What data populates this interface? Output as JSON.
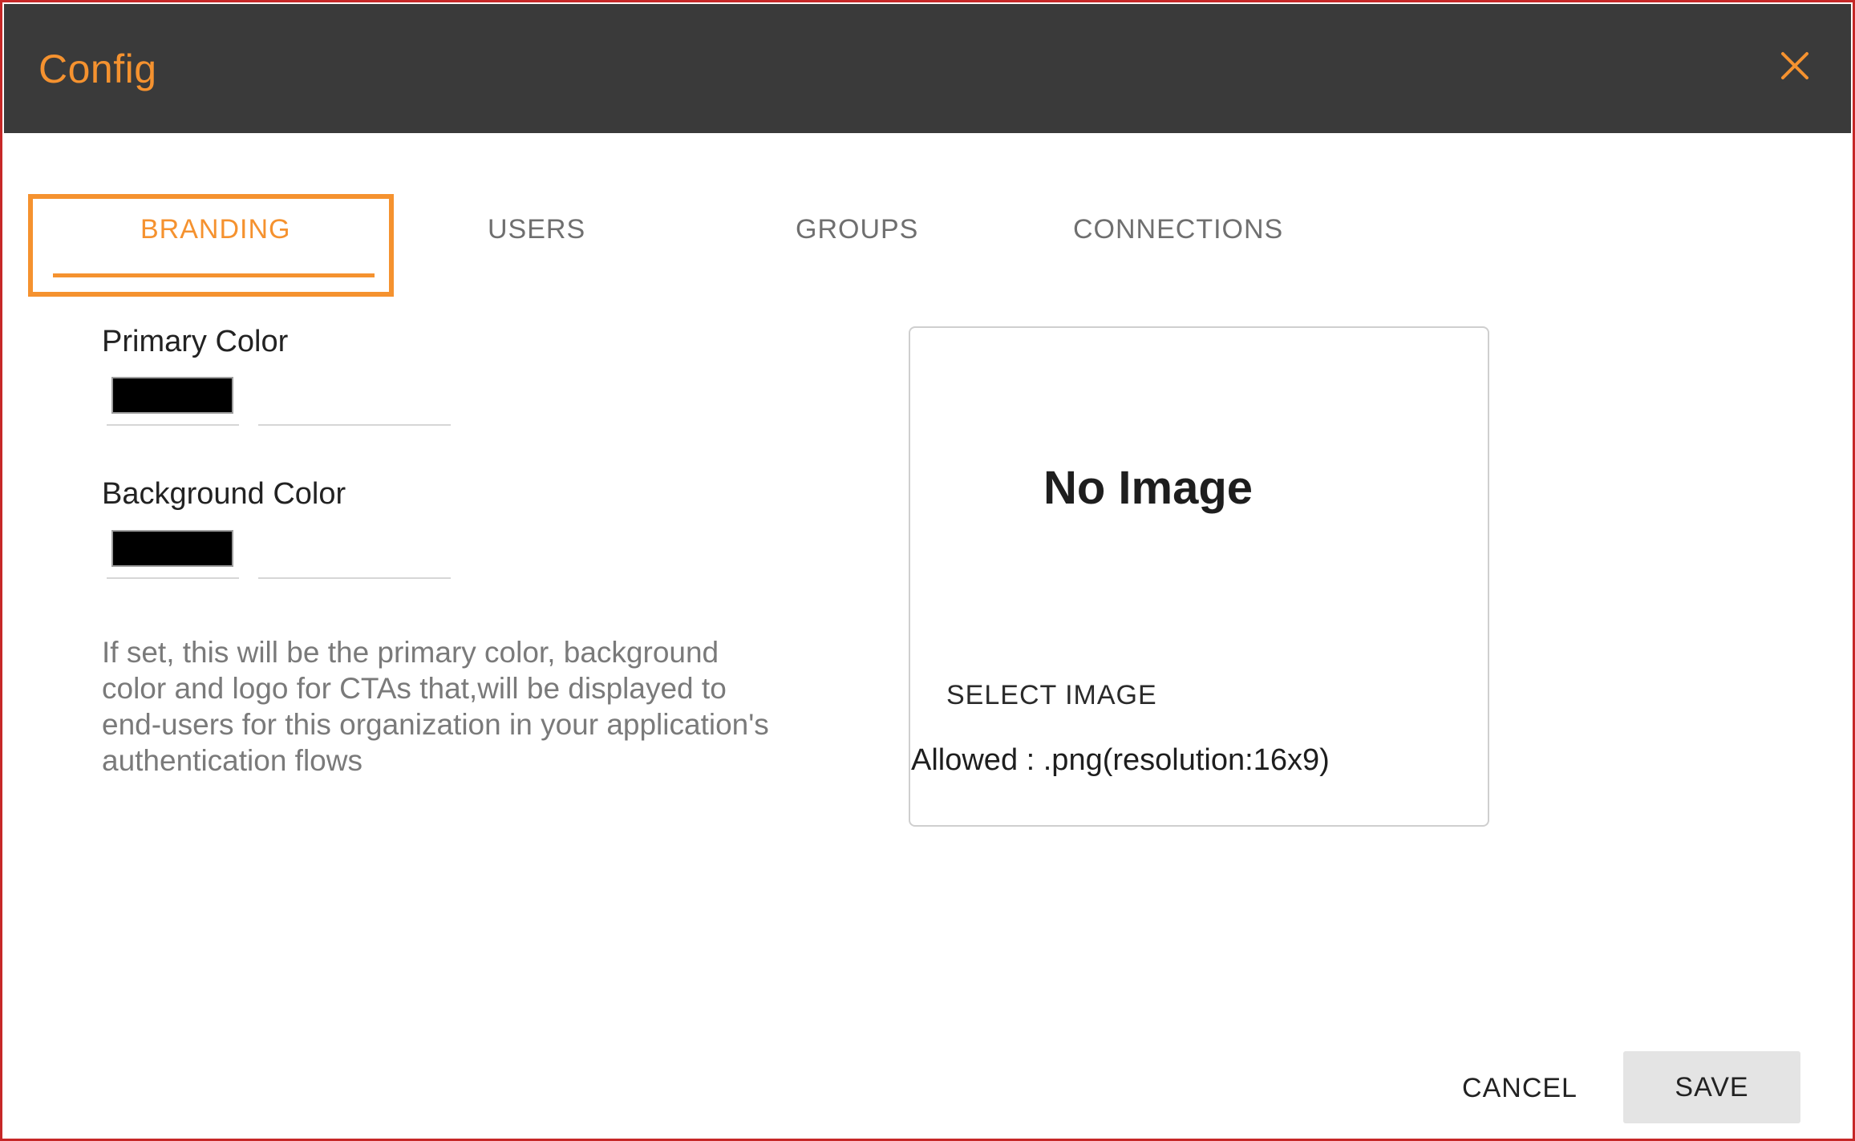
{
  "dialog": {
    "title": "Config",
    "close_icon": "close-icon"
  },
  "tabs": [
    {
      "label": "BRANDING",
      "active": true
    },
    {
      "label": "USERS",
      "active": false
    },
    {
      "label": "GROUPS",
      "active": false
    },
    {
      "label": "CONNECTIONS",
      "active": false
    }
  ],
  "branding": {
    "primary_color": {
      "label": "Primary Color",
      "swatch": "#000000",
      "value": ""
    },
    "background_color": {
      "label": "Background Color",
      "swatch": "#000000",
      "value": ""
    },
    "helper_text": "If set, this will be the primary color, background color and logo for CTAs that,will be displayed to end-users for this organization in your application's authentication flows"
  },
  "image_card": {
    "placeholder": "No Image",
    "select_label": "SELECT IMAGE",
    "allowed_text": "Allowed : .png(resolution:16x9)"
  },
  "footer": {
    "cancel_label": "CANCEL",
    "save_label": "SAVE"
  },
  "colors": {
    "accent": "#f5922f",
    "titlebar": "#3a3a3a",
    "frame_border": "#c62828"
  }
}
